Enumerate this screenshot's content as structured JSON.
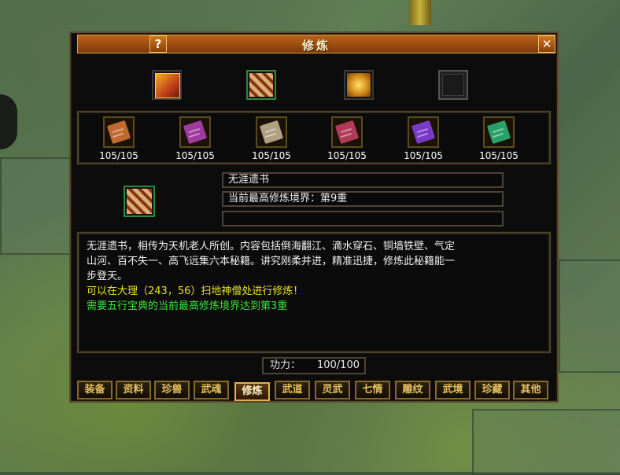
{
  "window": {
    "title": "修炼",
    "help_label": "?",
    "close_label": "✕"
  },
  "top_slots": [
    {
      "name": "red-book-icon",
      "color": "#c0401a"
    },
    {
      "name": "scroll-bundle-icon",
      "color": "#8a3018"
    },
    {
      "name": "golden-book-icon",
      "color": "#d08a18"
    },
    {
      "name": "empty-slot",
      "color": "#222222"
    }
  ],
  "books": [
    {
      "count": "105/105",
      "color": "#c06a30"
    },
    {
      "count": "105/105",
      "color": "#a03aa0"
    },
    {
      "count": "105/105",
      "color": "#b0a080"
    },
    {
      "count": "105/105",
      "color": "#b03a5a"
    },
    {
      "count": "105/105",
      "color": "#7a3ac8"
    },
    {
      "count": "105/105",
      "color": "#2aa06a"
    }
  ],
  "selected": {
    "icon": "scroll-bundle-icon",
    "name": "无涯遗书",
    "realm": "当前最高修炼境界：第9重",
    "extra": ""
  },
  "description": {
    "line1": "无涯遗书，相传为天机老人所创。内容包括倒海翻江、滴水穿石、铜墙铁壁、气定",
    "line2": "山河、百不失一、高飞远集六本秘籍。讲究刚柔并进，精准迅捷，修炼此秘籍能一",
    "line3": "步登天。",
    "hint_location": "可以在大理（243，56）扫地神僧处进行修炼！",
    "requirement": "需要五行宝典的当前最高修炼境界达到第3重"
  },
  "power": {
    "label": "功力：",
    "value": "100/100"
  },
  "tabs": [
    "装备",
    "资料",
    "珍兽",
    "武魂",
    "修炼",
    "武道",
    "灵武",
    "七情",
    "雕纹",
    "武境",
    "珍藏",
    "其他"
  ],
  "active_tab": "修炼"
}
